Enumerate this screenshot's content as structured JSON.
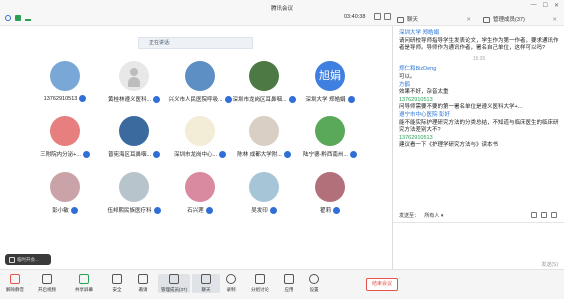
{
  "window": {
    "title": "腾讯会议",
    "timer": "03:40:38"
  },
  "speaking": "正在讲话:",
  "participants": [
    {
      "name": "13762910513"
    },
    {
      "name": "黄桂林遵义医科..."
    },
    {
      "name": "兴义市人民医院呼吸..."
    },
    {
      "name": "深圳市龙岗区耳鼻咽..."
    },
    {
      "name": "深圳大学 郑皓娟",
      "initials": "旭娟"
    },
    {
      "name": "三附院内分泌+..."
    },
    {
      "name": "普宪海区耳鼻咽..."
    },
    {
      "name": "深圳市龙岗中心..."
    },
    {
      "name": "陈林 成都大学附..."
    },
    {
      "name": "陆宁德-黔西南州..."
    },
    {
      "name": "彭小敏"
    },
    {
      "name": "伍邦熙民族医疗科"
    },
    {
      "name": "石兴莲"
    },
    {
      "name": "吴发印"
    },
    {
      "name": "翟莉"
    }
  ],
  "hint": "临时开会...",
  "panel": {
    "chat_tab": "聊天",
    "members_tab": "管理成员(37)",
    "messages": [
      {
        "name": "深圳大学 郑皓娟",
        "text": "请问研校导师指导学生发表论文，学生作为第一作者，要求通讯作者是导师。导师作为通讯作者，署名自己单位，这样可以吗?"
      },
      {
        "time": "15:35"
      },
      {
        "name": "郑仁和BizDeng",
        "text": "可以。"
      },
      {
        "name": "方鹤",
        "text": "效果不好，杂音太重"
      },
      {
        "name": "13762910513",
        "green": true,
        "text": "问导师需要不要的第一署名单位是遵义医科大学+..."
      },
      {
        "name": "遵宁市中心医院 彭好",
        "text": "能不能实际护理研究方法的分类总结，不知道与临床医生的临床研究方法差别大不?"
      },
      {
        "name": "13762910513",
        "green": true,
        "text": "建议看一下《护理学研究方法与》读本书"
      }
    ],
    "send_to_label": "发送至：",
    "send_to_value": "所有人",
    "send_button": "发送(S)"
  },
  "toolbar": {
    "items": [
      {
        "label": "解除静音"
      },
      {
        "label": "开启视频"
      },
      {
        "label": "共享屏幕"
      },
      {
        "label": "安全"
      },
      {
        "label": "邀请"
      },
      {
        "label": "管理成员(37)"
      },
      {
        "label": "聊天"
      },
      {
        "label": "录制"
      },
      {
        "label": "分组讨论"
      },
      {
        "label": "应用"
      },
      {
        "label": "设置"
      }
    ],
    "leave": "结束会议"
  }
}
